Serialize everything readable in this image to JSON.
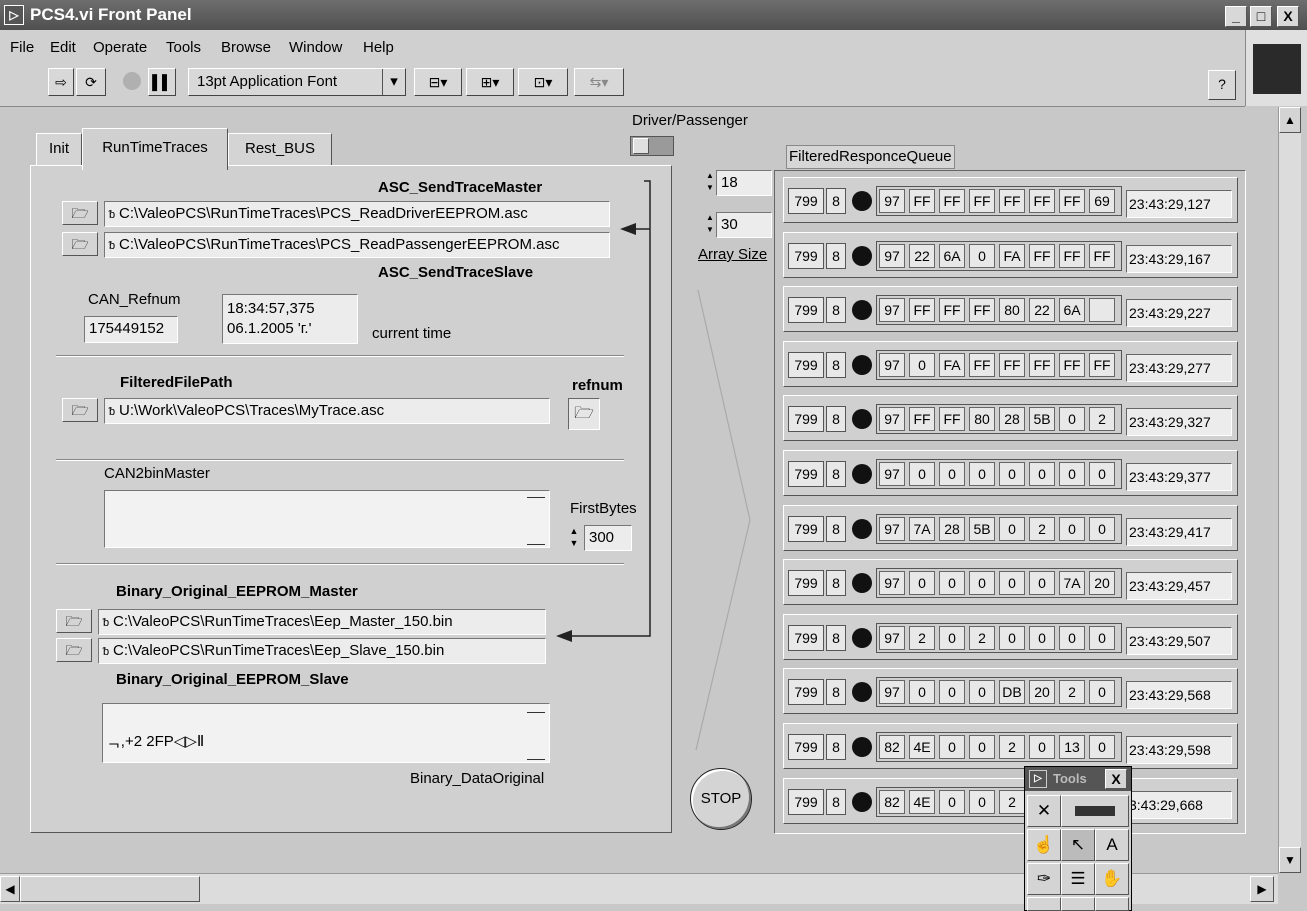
{
  "window": {
    "title": "PCS4.vi Front Panel",
    "minimize": "_",
    "maximize": "□",
    "close": "X"
  },
  "menu": [
    "File",
    "Edit",
    "Operate",
    "Tools",
    "Browse",
    "Window",
    "Help"
  ],
  "toolbar": {
    "font_name": "13pt Application Font",
    "help": "?"
  },
  "tabs": [
    "Init",
    "RunTimeTraces",
    "Rest_BUS"
  ],
  "driver_passenger_label": "Driver/Passenger",
  "asc_master_label": "ASC_SendTraceMaster",
  "asc_master_path": "C:\\ValeoPCS\\RunTimeTraces\\PCS_ReadDriverEEPROM.asc",
  "asc_slave_path": "C:\\ValeoPCS\\RunTimeTraces\\PCS_ReadPassengerEEPROM.asc",
  "asc_slave_label": "ASC_SendTraceSlave",
  "can_refnum_label": "CAN_Refnum",
  "can_refnum_value": "175449152",
  "current_time_line1": "18:34:57,375",
  "current_time_line2": "06.1.2005 'г.'",
  "current_time_label": "current time",
  "filtered_label": "FilteredFilePath",
  "filtered_path": "U:\\Work\\ValeoPCS\\Traces\\MyTrace.asc",
  "refnum_label": "refnum",
  "can2bin_label": "CAN2binMaster",
  "first_bytes_label": "FirstBytes",
  "first_bytes_value": "300",
  "bin_master_label": "Binary_Original_EEPROM_Master",
  "bin_master_path": "C:\\ValeoPCS\\RunTimeTraces\\Eep_Master_150.bin",
  "bin_slave_path": "C:\\ValeoPCS\\RunTimeTraces\\Eep_Slave_150.bin",
  "bin_slave_label": "Binary_Original_EEPROM_Slave",
  "binary_data_text": "ᆨ,+2 2FP◁▷Ⅱ",
  "binary_data_label": "Binary_DataOriginal",
  "array_index": "18",
  "array_size_value": "30",
  "array_size_label": "Array Size",
  "queue_label": "FilteredResponceQueue",
  "stop_label": "STOP",
  "tools_title": "Tools",
  "tools_close": "X",
  "queue": [
    {
      "id": "799",
      "len": "8",
      "bytes": [
        "97",
        "FF",
        "FF",
        "FF",
        "FF",
        "FF",
        "FF",
        "69"
      ],
      "time": "23:43:29,127"
    },
    {
      "id": "799",
      "len": "8",
      "bytes": [
        "97",
        "22",
        "6A",
        "0",
        "FA",
        "FF",
        "FF",
        "FF"
      ],
      "time": "23:43:29,167"
    },
    {
      "id": "799",
      "len": "8",
      "bytes": [
        "97",
        "FF",
        "FF",
        "FF",
        "80",
        "22",
        "6A",
        ""
      ],
      "time": "23:43:29,227"
    },
    {
      "id": "799",
      "len": "8",
      "bytes": [
        "97",
        "0",
        "FA",
        "FF",
        "FF",
        "FF",
        "FF",
        "FF"
      ],
      "time": "23:43:29,277"
    },
    {
      "id": "799",
      "len": "8",
      "bytes": [
        "97",
        "FF",
        "FF",
        "80",
        "28",
        "5B",
        "0",
        "2"
      ],
      "time": "23:43:29,327"
    },
    {
      "id": "799",
      "len": "8",
      "bytes": [
        "97",
        "0",
        "0",
        "0",
        "0",
        "0",
        "0",
        "0"
      ],
      "time": "23:43:29,377"
    },
    {
      "id": "799",
      "len": "8",
      "bytes": [
        "97",
        "7A",
        "28",
        "5B",
        "0",
        "2",
        "0",
        "0"
      ],
      "time": "23:43:29,417"
    },
    {
      "id": "799",
      "len": "8",
      "bytes": [
        "97",
        "0",
        "0",
        "0",
        "0",
        "0",
        "7A",
        "20"
      ],
      "time": "23:43:29,457"
    },
    {
      "id": "799",
      "len": "8",
      "bytes": [
        "97",
        "2",
        "0",
        "2",
        "0",
        "0",
        "0",
        "0"
      ],
      "time": "23:43:29,507"
    },
    {
      "id": "799",
      "len": "8",
      "bytes": [
        "97",
        "0",
        "0",
        "0",
        "DB",
        "20",
        "2",
        "0"
      ],
      "time": "23:43:29,568"
    },
    {
      "id": "799",
      "len": "8",
      "bytes": [
        "82",
        "4E",
        "0",
        "0",
        "2",
        "0",
        "13",
        "0"
      ],
      "time": "23:43:29,598"
    },
    {
      "id": "799",
      "len": "8",
      "bytes": [
        "82",
        "4E",
        "0",
        "0",
        "2",
        "",
        "",
        ""
      ],
      "time": "3:43:29,668"
    }
  ]
}
